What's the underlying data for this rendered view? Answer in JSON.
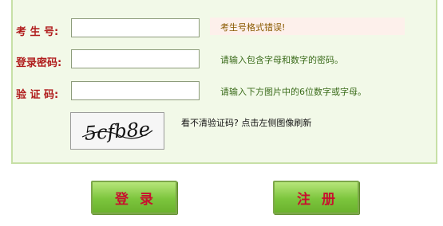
{
  "form": {
    "exam_no_label": "考 生 号:",
    "exam_no_value": "",
    "exam_no_error": "考生号格式错误!",
    "password_label": "登录密码:",
    "password_value": "",
    "password_hint": "请输入包含字母和数字的密码。",
    "captcha_label": "验 证 码:",
    "captcha_value": "",
    "captcha_hint": "请输入下方图片中的6位数字或字母。",
    "captcha_image_text": "5cfb8e",
    "refresh_text": "看不清验证码? 点击左侧图像刷新"
  },
  "buttons": {
    "login": "登录",
    "register": "注册"
  },
  "colors": {
    "label_red": "#b01c1c",
    "hint_green": "#3a6b1a",
    "panel_bg": "#f2f9e8",
    "panel_border": "#c7e0a6",
    "button_green": "#7cc53d",
    "button_text": "#c8102e"
  }
}
